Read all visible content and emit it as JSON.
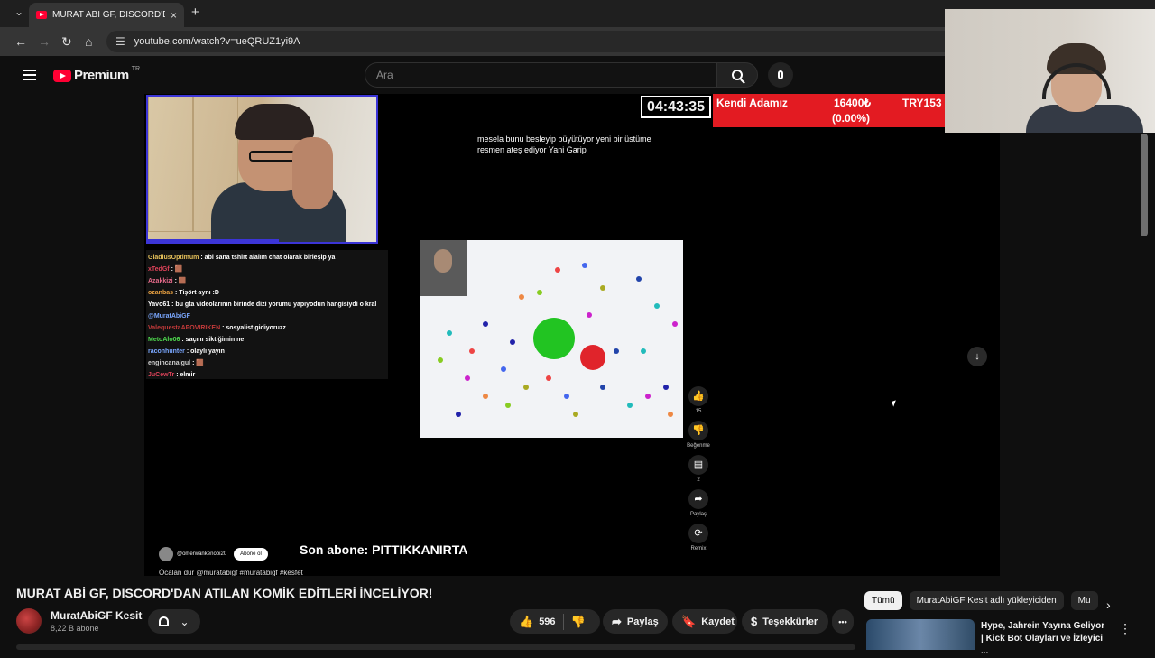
{
  "browser": {
    "tab_title": "MURAT ABİ GF, DISCORD'DAN",
    "tab_close": "×",
    "new_tab": "+",
    "url": "youtube.com/watch?v=ueQRUZ1yi9A",
    "nav": {
      "back": "←",
      "forward": "→",
      "reload": "↻",
      "home": "⌂",
      "tabs_menu": "⌄"
    }
  },
  "yt_header": {
    "logo_text": "Premium",
    "country": "TR",
    "search_placeholder": "Ara"
  },
  "stream": {
    "timer": "04:43:35",
    "banner_name": "Kendi Adamız",
    "banner_value": "16400₺",
    "banner_currency": "TRY153",
    "banner_change": "(0.00%)",
    "subtitle": "mesela bunu besleyip büyütüyor yeni bir üstüme resmen ateş ediyor Yani Garip",
    "last_sub": "Son abone: PITTIKKANIRTA",
    "chat": [
      {
        "user": "GladiusOptimum",
        "color": "#e6c15a",
        "msg": ": abi sana tshirt alalım chat olarak birleşip ya"
      },
      {
        "user": "xTedGf",
        "color": "#e0435a",
        "msg": ": 🟫"
      },
      {
        "user": "Azakkizi",
        "color": "#e66a8a",
        "msg": ": 🟫"
      },
      {
        "user": "ozanbas",
        "color": "#e8a040",
        "msg": ": Tişört aynı :D"
      },
      {
        "user": "Yavo61",
        "color": "#ffffff",
        "msg": ": bu gta videolarının birinde dizi yorumu yapıyodun hangisiydi o kral"
      },
      {
        "user": "@MuratAbiGF",
        "color": "#7aa7ff",
        "msg": ""
      },
      {
        "user": "ValequestaAPOVIRIKEN",
        "color": "#c33a3a",
        "msg": ": sosyalist gidiyoruzz"
      },
      {
        "user": "MetoAlo06",
        "color": "#4fdc4f",
        "msg": ": saçını siktiğimin ne"
      },
      {
        "user": "raconhunter",
        "color": "#7aa7ff",
        "msg": ": olaylı yayın"
      },
      {
        "user": "engincanalgul",
        "color": "#cccccc",
        "msg": ": 🟫"
      },
      {
        "user": "JuCewTr",
        "color": "#e0435a",
        "msg": ": elmir"
      }
    ]
  },
  "shorts": {
    "like_count": "15",
    "dislike_label": "Beğenme",
    "comment_count": "2",
    "share_label": "Paylaş",
    "remix_label": "Remix",
    "channel": "@omerwankenobi20",
    "subscribe": "Abone ol",
    "caption": "Öcalan dur @muratabigf #muratabigf #kesfet"
  },
  "video": {
    "title": "MURAT ABİ GF, DISCORD'DAN ATILAN KOMİK EDİTLERİ İNCELİYOR!",
    "channel_name": "MuratAbiGF Kesit",
    "subscribers": "8,22 B abone",
    "likes": "596",
    "share": "Paylaş",
    "save": "Kaydet",
    "thanks": "Teşekkürler",
    "more": "•••"
  },
  "recommendations": {
    "chips": [
      "Tümü",
      "MuratAbiGF Kesit adlı yükleyiciden",
      "Mu"
    ],
    "first_title": "Hype, Jahrein Yayına Geliyor | Kick Bot Olayları ve İzleyici ..."
  },
  "icons": {
    "down_arrow": "↓",
    "chevron_right": "›",
    "kebab": "⋮"
  }
}
